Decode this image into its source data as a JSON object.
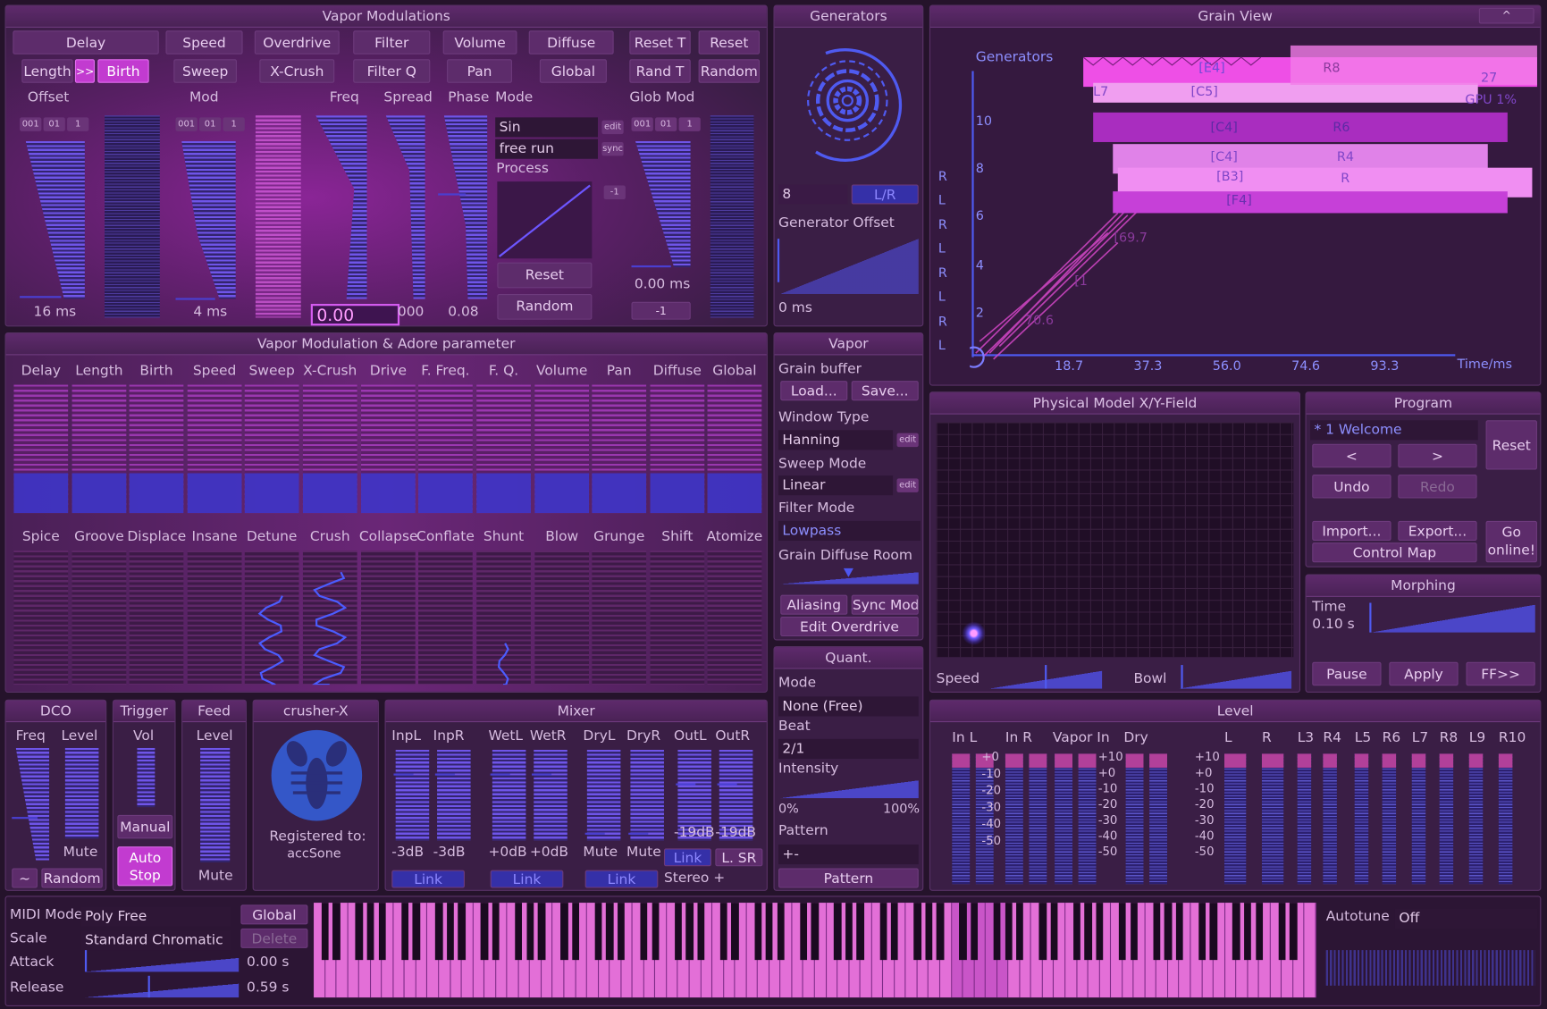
{
  "vapor_mod": {
    "title": "Vapor Modulations",
    "row1": [
      "Delay",
      "Speed",
      "Overdrive",
      "Filter",
      "Volume",
      "Diffuse",
      "Reset T",
      "Reset"
    ],
    "row2": [
      "Length",
      ">>",
      "Birth",
      "Sweep",
      "X-Crush",
      "Filter Q",
      "Pan",
      "Global",
      "Rand T",
      "Random"
    ],
    "labels": {
      "offset": "Offset",
      "mod": "Mod",
      "freq": "Freq",
      "spread": "Spread",
      "phase": "Phase",
      "mode": "Mode",
      "glob_mod": "Glob Mod"
    },
    "mini": [
      "001",
      "01",
      "1"
    ],
    "mode_fields": [
      "Sin",
      "free run",
      "Process"
    ],
    "mode_mini": [
      "edit",
      "sync",
      "-1"
    ],
    "reset_label": "Reset",
    "random_label": "Random",
    "values": {
      "offset": "16 ms",
      "mod": "4 ms",
      "freq_input": "0.00",
      "freq_tail": "000",
      "phase": "0.08",
      "glob_mod": "0.00 ms",
      "glob_btn": "-1"
    }
  },
  "generators": {
    "title": "Generators",
    "count": "8",
    "lr": "L/R",
    "offset_label": "Generator Offset",
    "offset_value": "0 ms"
  },
  "grain_view": {
    "title": "Grain View",
    "corner": "^",
    "gen_label": "Generators",
    "y_ticks": [
      "10",
      "8",
      "6",
      "4",
      "2"
    ],
    "lr": [
      "R",
      "L",
      "R",
      "L",
      "R",
      "L",
      "R",
      "L"
    ],
    "x_ticks": [
      "18.7",
      "37.3",
      "56.0",
      "74.6",
      "93.3"
    ],
    "x_unit": "Time/ms",
    "boxes": [
      "[E4]",
      "R8",
      "L7",
      "[C5]",
      "[C4]",
      "R6",
      "[C4]",
      "R4",
      "[B3]",
      "R",
      "[F4]",
      "27"
    ],
    "diag": [
      "[69.7",
      "[1",
      "70.6"
    ],
    "gpu": "GPU 1%"
  },
  "vmap": {
    "title": "Vapor Modulation & Adore parameter",
    "row1": [
      "Delay",
      "Length",
      "Birth",
      "Speed",
      "Sweep",
      "X-Crush",
      "Drive",
      "F. Freq.",
      "F. Q.",
      "Volume",
      "Pan",
      "Diffuse",
      "Global"
    ],
    "row2": [
      "Spice",
      "Groove",
      "Displace",
      "Insane",
      "Detune",
      "Crush",
      "Collapse",
      "Conflate",
      "Shunt",
      "Blow",
      "Grunge",
      "Shift",
      "Atomize"
    ]
  },
  "vapor": {
    "title": "Vapor",
    "grain_buffer": "Grain buffer",
    "load": "Load...",
    "save": "Save...",
    "window_type": "Window Type",
    "window_value": "Hanning",
    "edit": "edit",
    "sweep_mode": "Sweep Mode",
    "sweep_value": "Linear",
    "filter_mode": "Filter Mode",
    "filter_value": "Lowpass",
    "diffuse_room": "Grain Diffuse Room",
    "aliasing": "Aliasing",
    "sync_mod": "Sync Mod",
    "edit_overdrive": "Edit Overdrive"
  },
  "quant": {
    "title": "Quant.",
    "mode": "Mode",
    "mode_value": "None (Free)",
    "beat": "Beat",
    "beat_value": "2/1",
    "intensity": "Intensity",
    "i_min": "0%",
    "i_max": "100%",
    "pattern": "Pattern",
    "pattern_value": "+-",
    "pattern_btn": "Pattern"
  },
  "xy": {
    "title": "Physical Model X/Y-Field",
    "speed": "Speed",
    "bowl": "Bowl"
  },
  "program": {
    "title": "Program",
    "current": "* 1 Welcome",
    "prev": "<",
    "next": ">",
    "reset": "Reset",
    "undo": "Undo",
    "redo": "Redo",
    "import": "Import...",
    "export": "Export...",
    "go_online": "Go online!",
    "control_map": "Control Map"
  },
  "morphing": {
    "title": "Morphing",
    "time": "Time",
    "time_value": "0.10 s",
    "pause": "Pause",
    "apply": "Apply",
    "ff": "FF>>"
  },
  "dco": {
    "title": "DCO",
    "freq": "Freq",
    "level": "Level",
    "mute": "Mute",
    "tilde": "~",
    "random": "Random"
  },
  "trigger": {
    "title": "Trigger",
    "vol": "Vol",
    "manual": "Manual",
    "auto_stop": "Auto Stop"
  },
  "feed": {
    "title": "Feed",
    "level": "Level",
    "mute": "Mute"
  },
  "crusher": {
    "title": "crusher-X",
    "registered": "Registered to:",
    "user": "accSone"
  },
  "mixer": {
    "title": "Mixer",
    "channels": [
      "InpL",
      "InpR",
      "WetL",
      "WetR",
      "DryL",
      "DryR",
      "OutL",
      "OutR"
    ],
    "values": [
      "-3dB",
      "-3dB",
      "+0dB",
      "+0dB",
      "Mute",
      "Mute",
      "-19dB",
      "-19dB"
    ],
    "link": "Link",
    "lsr": "L. SR",
    "stereo": "Stereo +"
  },
  "level": {
    "title": "Level",
    "groups": [
      "In L",
      "In R",
      "Vapor In",
      "Dry"
    ],
    "outs": [
      "L",
      "R",
      "L3",
      "R4",
      "L5",
      "R6",
      "L7",
      "R8",
      "L9",
      "R10"
    ],
    "scale_a": [
      "+0",
      "-10",
      "-20",
      "-30",
      "-40",
      "-50"
    ],
    "scale_b": [
      "+10",
      "+0",
      "-10",
      "-20",
      "-30",
      "-40",
      "-50"
    ]
  },
  "midi": {
    "mode_label": "MIDI Mode",
    "mode_value": "Poly Free",
    "global": "Global",
    "delete": "Delete",
    "scale_label": "Scale",
    "scale_value": "Standard Chromatic",
    "attack_label": "Attack",
    "attack_value": "0.00 s",
    "release_label": "Release",
    "release_value": "0.59 s",
    "autotune_label": "Autotune",
    "autotune_value": "Off"
  }
}
